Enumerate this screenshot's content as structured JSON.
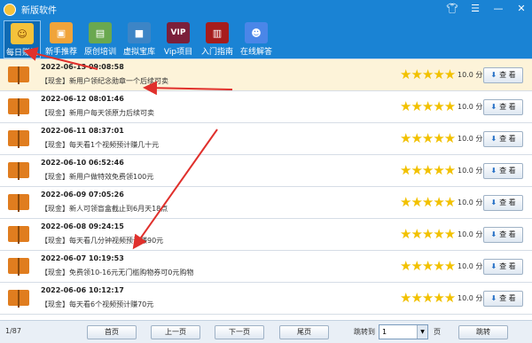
{
  "window": {
    "title": "新版软件"
  },
  "toolbar": {
    "items": [
      {
        "label": "每日赚钱",
        "icon": "cat-icon",
        "color": "#f5c23b"
      },
      {
        "label": "新手推荐",
        "icon": "monitor-icon",
        "color": "#f0a43a"
      },
      {
        "label": "原创培训",
        "icon": "book-icon",
        "color": "#6aa84f"
      },
      {
        "label": "虚拟宝库",
        "icon": "folder-icon",
        "color": "#3d85c6"
      },
      {
        "label": "Vip项目",
        "icon": "vip-icon",
        "color": "#7b1f3a"
      },
      {
        "label": "入门指南",
        "icon": "guide-book-icon",
        "color": "#a61c1c"
      },
      {
        "label": "在线解答",
        "icon": "people-icon",
        "color": "#4a86e8"
      }
    ]
  },
  "list": {
    "rows": [
      {
        "date": "2022-06-13 09:08:58",
        "text": "【现金】新用户领纪念勋章一个后续可卖",
        "score": "10.0 分",
        "view": "查 看",
        "rating": 5
      },
      {
        "date": "2022-06-12 08:01:46",
        "text": "【现金】新用户每天领原力后续可卖",
        "score": "10.0 分",
        "view": "查 看",
        "rating": 5
      },
      {
        "date": "2022-06-11 08:37:01",
        "text": "【现金】每天看1个视频预计赚几十元",
        "score": "10.0 分",
        "view": "查 看",
        "rating": 5
      },
      {
        "date": "2022-06-10 06:52:46",
        "text": "【现金】新用户做特效免费领100元",
        "score": "10.0 分",
        "view": "查 看",
        "rating": 5
      },
      {
        "date": "2022-06-09 07:05:26",
        "text": "【现金】新人可领盲盒截止到6月天18点",
        "score": "10.0 分",
        "view": "查 看",
        "rating": 5
      },
      {
        "date": "2022-06-08 09:24:15",
        "text": "【现金】每天看几分钟视频预计赚90元",
        "score": "10.0 分",
        "view": "查 看",
        "rating": 5
      },
      {
        "date": "2022-06-07 10:19:53",
        "text": "【现金】免费领10-16元无门槛购物券可0元购物",
        "score": "10.0 分",
        "view": "查 看",
        "rating": 5
      },
      {
        "date": "2022-06-06 10:12:17",
        "text": "【现金】每天看6个视频预计赚70元",
        "score": "10.0 分",
        "view": "查 看",
        "rating": 5
      }
    ]
  },
  "footer": {
    "page_info": "1/87",
    "first": "首页",
    "prev": "上一页",
    "next": "下一页",
    "last": "尾页",
    "jump_label": "跳转到",
    "jump_value": "1",
    "page_label": "页",
    "jump_button": "跳转"
  },
  "colors": {
    "title_bar": "#1a83d4",
    "selected_row": "#fdf3d9",
    "star": "#f2c100",
    "arrow": "#e0302c"
  }
}
